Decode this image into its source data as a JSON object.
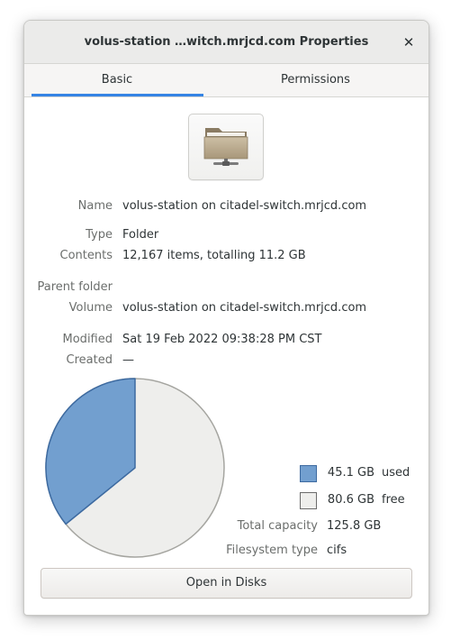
{
  "window": {
    "title": "volus-station …witch.mrjcd.com Properties",
    "close_glyph": "✕"
  },
  "tabs": [
    {
      "label": "Basic",
      "selected": true
    },
    {
      "label": "Permissions",
      "selected": false
    }
  ],
  "icon": {
    "name": "folder-remote-icon"
  },
  "properties": {
    "name_label": "Name",
    "name_value": "volus-station on citadel-switch.mrjcd.com",
    "type_label": "Type",
    "type_value": "Folder",
    "contents_label": "Contents",
    "contents_value": "12,167 items, totalling 11.2 GB",
    "parent_label": "Parent folder",
    "volume_label": "Volume",
    "volume_value": "volus-station on citadel-switch.mrjcd.com",
    "modified_label": "Modified",
    "modified_value": "Sat 19 Feb 2022 09:38:28 PM CST",
    "created_label": "Created",
    "created_value": "—"
  },
  "usage": {
    "used_fraction": 0.3585,
    "used_value": "45.1 GB",
    "used_label": "used",
    "free_value": "80.6 GB",
    "free_label": "free",
    "capacity_label": "Total capacity",
    "capacity_value": "125.8 GB",
    "fstype_label": "Filesystem type",
    "fstype_value": "cifs",
    "colors": {
      "used": "#729fcf",
      "used_stroke": "#3d6aa0",
      "free": "#eeeeec",
      "free_stroke": "#a5a5a0"
    }
  },
  "actions": {
    "open_disks_label": "Open in Disks"
  }
}
